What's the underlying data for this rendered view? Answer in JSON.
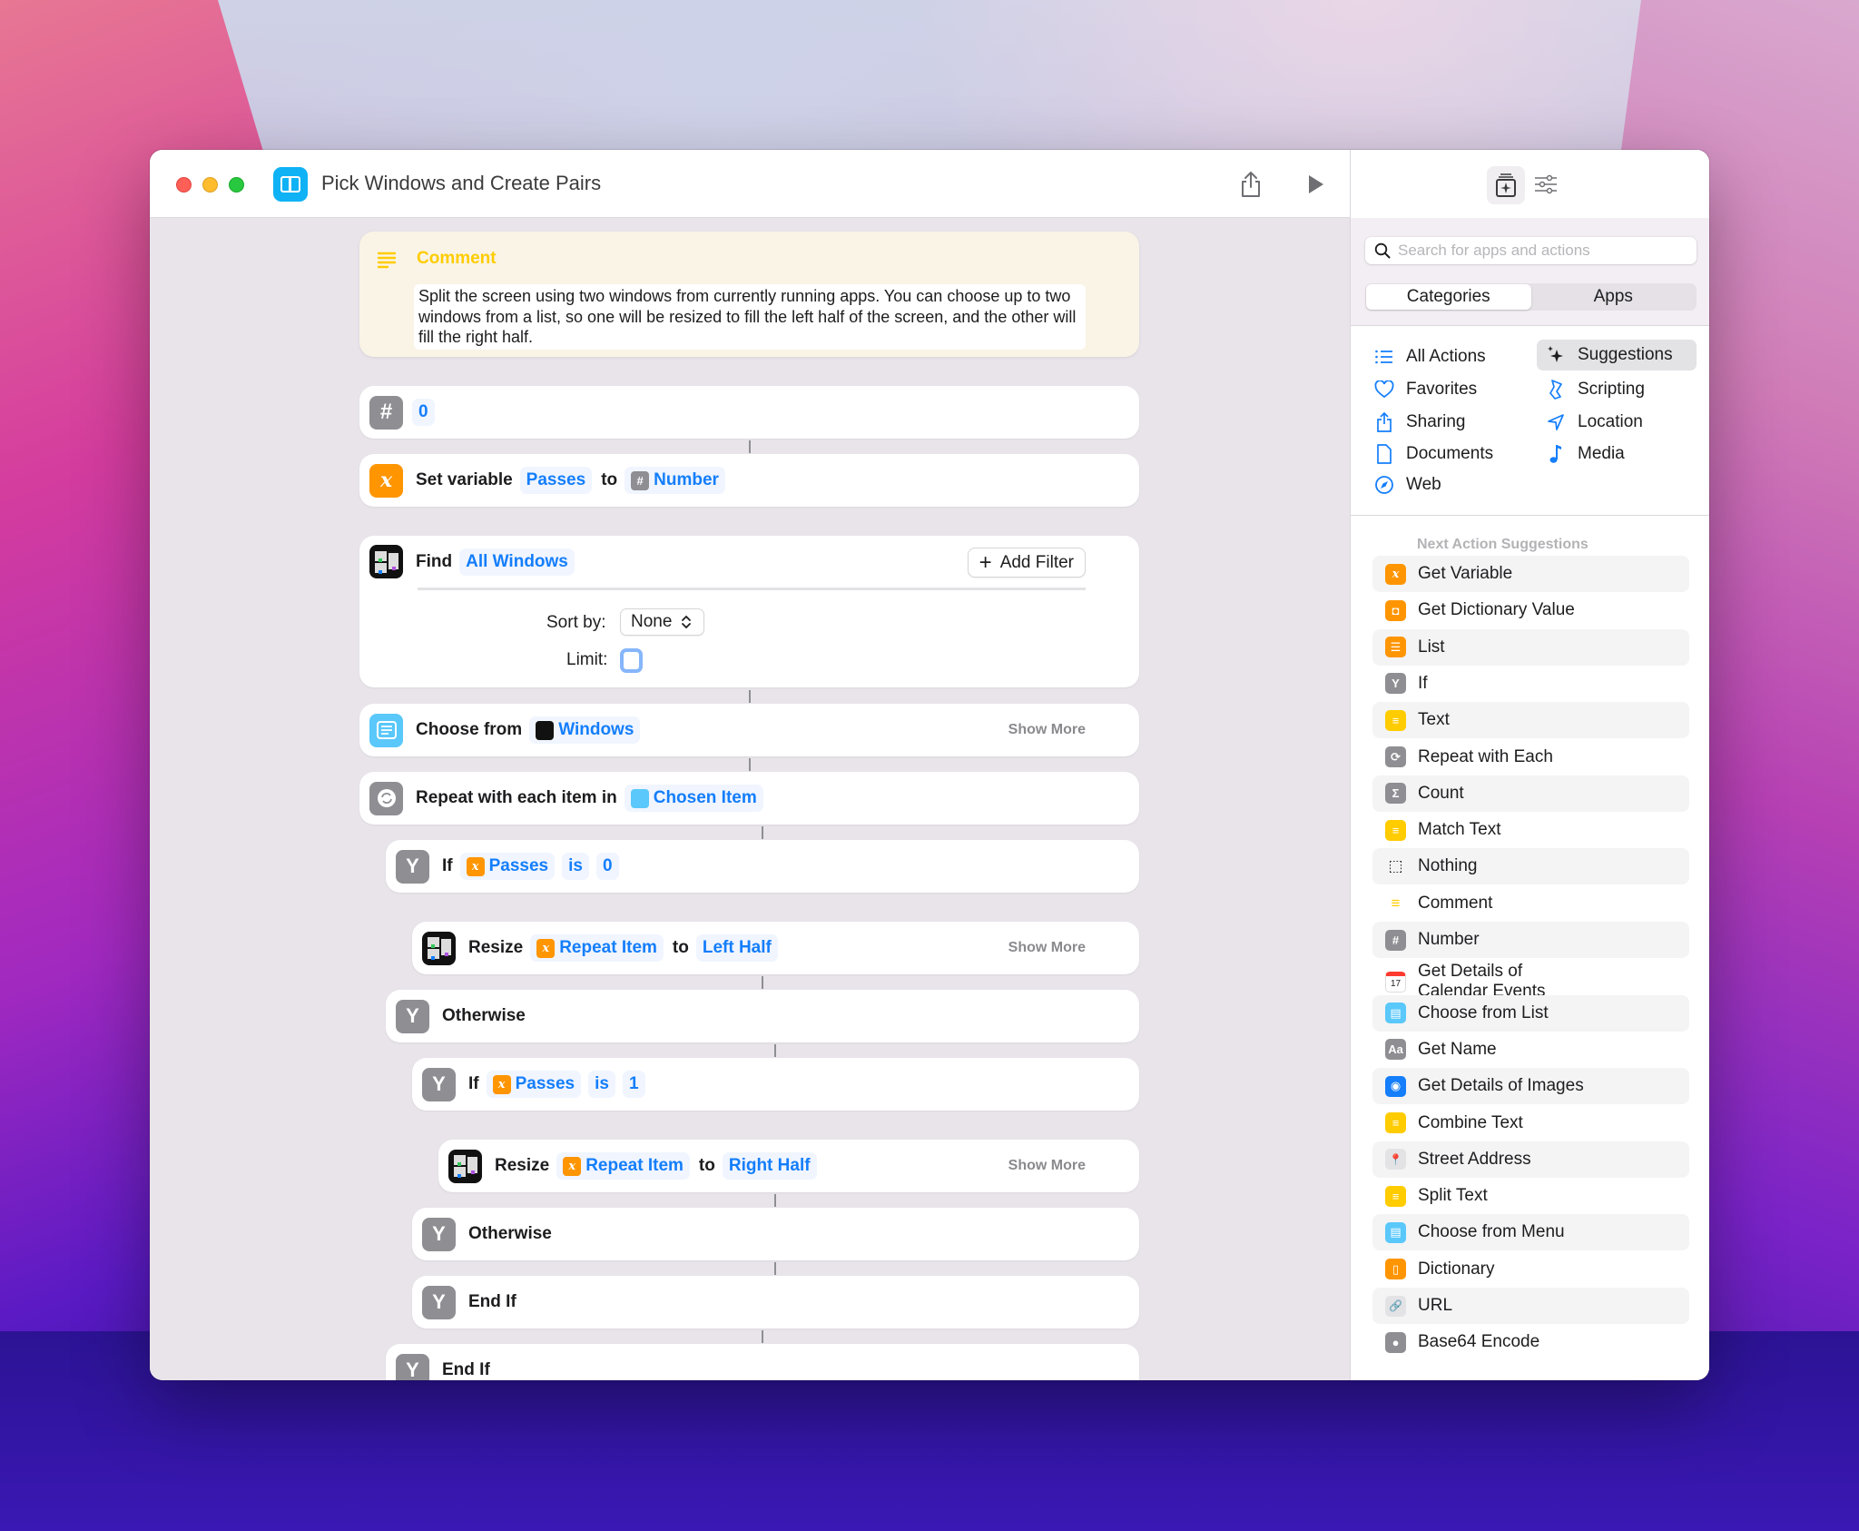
{
  "window": {
    "title": "Pick Windows and Create Pairs",
    "app_icon": "split-view-icon",
    "toolbar": {
      "share_icon": "share-icon",
      "run_icon": "play-icon"
    }
  },
  "editor": {
    "comment": {
      "title": "Comment",
      "text": "Split the screen using two windows from currently running apps. You can choose up to two windows from a list, so one will be resized to fill the left half of the screen, and the other will fill the right half."
    },
    "number_action": {
      "value": "0"
    },
    "set_variable": {
      "label": "Set variable",
      "variable": "Passes",
      "to": "to",
      "value": "Number"
    },
    "find": {
      "label": "Find",
      "target": "All Windows",
      "add_filter": "Add Filter",
      "sort_label": "Sort by:",
      "sort_value": "None",
      "limit_label": "Limit:",
      "limit_checked": false
    },
    "choose": {
      "label": "Choose from",
      "source": "Windows",
      "show_more": "Show More"
    },
    "repeat": {
      "label": "Repeat with each item in",
      "source": "Chosen Item"
    },
    "if1": {
      "label": "If",
      "variable": "Passes",
      "op": "is",
      "value": "0"
    },
    "resize1": {
      "label": "Resize",
      "item": "Repeat Item",
      "to": "to",
      "position": "Left Half",
      "show_more": "Show More"
    },
    "otherwise1": {
      "label": "Otherwise"
    },
    "if2": {
      "label": "If",
      "variable": "Passes",
      "op": "is",
      "value": "1"
    },
    "resize2": {
      "label": "Resize",
      "item": "Repeat Item",
      "to": "to",
      "position": "Right Half",
      "show_more": "Show More"
    },
    "otherwise2": {
      "label": "Otherwise"
    },
    "endif2": {
      "label": "End If"
    },
    "endif1": {
      "label": "End If"
    }
  },
  "sidebar": {
    "search_placeholder": "Search for apps and actions",
    "search_value": "",
    "segments": [
      {
        "label": "Categories",
        "active": true
      },
      {
        "label": "Apps",
        "active": false
      }
    ],
    "categories": [
      {
        "label": "All Actions",
        "icon": "list-icon",
        "color": "#147efb"
      },
      {
        "label": "Suggestions",
        "icon": "sparkles-icon",
        "color": "#1d1d1f",
        "active": true
      },
      {
        "label": "Favorites",
        "icon": "heart-icon",
        "color": "#147efb"
      },
      {
        "label": "Scripting",
        "icon": "scroll-icon",
        "color": "#147efb"
      },
      {
        "label": "Sharing",
        "icon": "share-icon",
        "color": "#147efb"
      },
      {
        "label": "Location",
        "icon": "location-arrow-icon",
        "color": "#147efb"
      },
      {
        "label": "Documents",
        "icon": "document-icon",
        "color": "#147efb"
      },
      {
        "label": "Media",
        "icon": "music-note-icon",
        "color": "#147efb"
      },
      {
        "label": "Web",
        "icon": "compass-icon",
        "color": "#147efb"
      }
    ],
    "suggestions_header": "Next Action Suggestions",
    "suggestions": [
      {
        "label": "Get Variable",
        "icon": "variable-icon",
        "color": "#ff9500",
        "glyph": "x"
      },
      {
        "label": "Get Dictionary Value",
        "icon": "dictionary-icon",
        "color": "#ff9500",
        "glyph": "◘"
      },
      {
        "label": "List",
        "icon": "list-icon",
        "color": "#ff9500",
        "glyph": "☰"
      },
      {
        "label": "If",
        "icon": "branch-icon",
        "color": "#8e8e93",
        "glyph": "Y"
      },
      {
        "label": "Text",
        "icon": "text-icon",
        "color": "#ffcc00",
        "glyph": "≡"
      },
      {
        "label": "Repeat with Each",
        "icon": "repeat-icon",
        "color": "#8e8e93",
        "glyph": "⟳"
      },
      {
        "label": "Count",
        "icon": "sigma-icon",
        "color": "#8e8e93",
        "glyph": "Σ"
      },
      {
        "label": "Match Text",
        "icon": "text-icon",
        "color": "#ffcc00",
        "glyph": "≡"
      },
      {
        "label": "Nothing",
        "icon": "dashed-square-icon",
        "color": "transparent",
        "glyph": "⬚"
      },
      {
        "label": "Comment",
        "icon": "comment-lines-icon",
        "color": "transparent",
        "glyph": "≡"
      },
      {
        "label": "Number",
        "icon": "hash-icon",
        "color": "#8e8e93",
        "glyph": "#"
      },
      {
        "label": "Get Details of Calendar Events",
        "icon": "calendar-icon",
        "color": "#ffffff",
        "glyph": "17"
      },
      {
        "label": "Choose from List",
        "icon": "choose-list-icon",
        "color": "#5ac8fa",
        "glyph": "▤"
      },
      {
        "label": "Get Name",
        "icon": "font-aa-icon",
        "color": "#8e8e93",
        "glyph": "Aa"
      },
      {
        "label": "Get Details of Images",
        "icon": "image-icon",
        "color": "#147efb",
        "glyph": "◉"
      },
      {
        "label": "Combine Text",
        "icon": "text-icon",
        "color": "#ffcc00",
        "glyph": "≡"
      },
      {
        "label": "Street Address",
        "icon": "map-pin-icon",
        "color": "#e3e3e6",
        "glyph": "📍"
      },
      {
        "label": "Split Text",
        "icon": "text-icon",
        "color": "#ffcc00",
        "glyph": "≡"
      },
      {
        "label": "Choose from Menu",
        "icon": "menu-icon",
        "color": "#5ac8fa",
        "glyph": "▤"
      },
      {
        "label": "Dictionary",
        "icon": "book-icon",
        "color": "#ff9500",
        "glyph": "▯"
      },
      {
        "label": "URL",
        "icon": "link-icon",
        "color": "#e3e3e6",
        "glyph": "🔗"
      },
      {
        "label": "Base64 Encode",
        "icon": "base64-icon",
        "color": "#8e8e93",
        "glyph": "●"
      }
    ]
  }
}
